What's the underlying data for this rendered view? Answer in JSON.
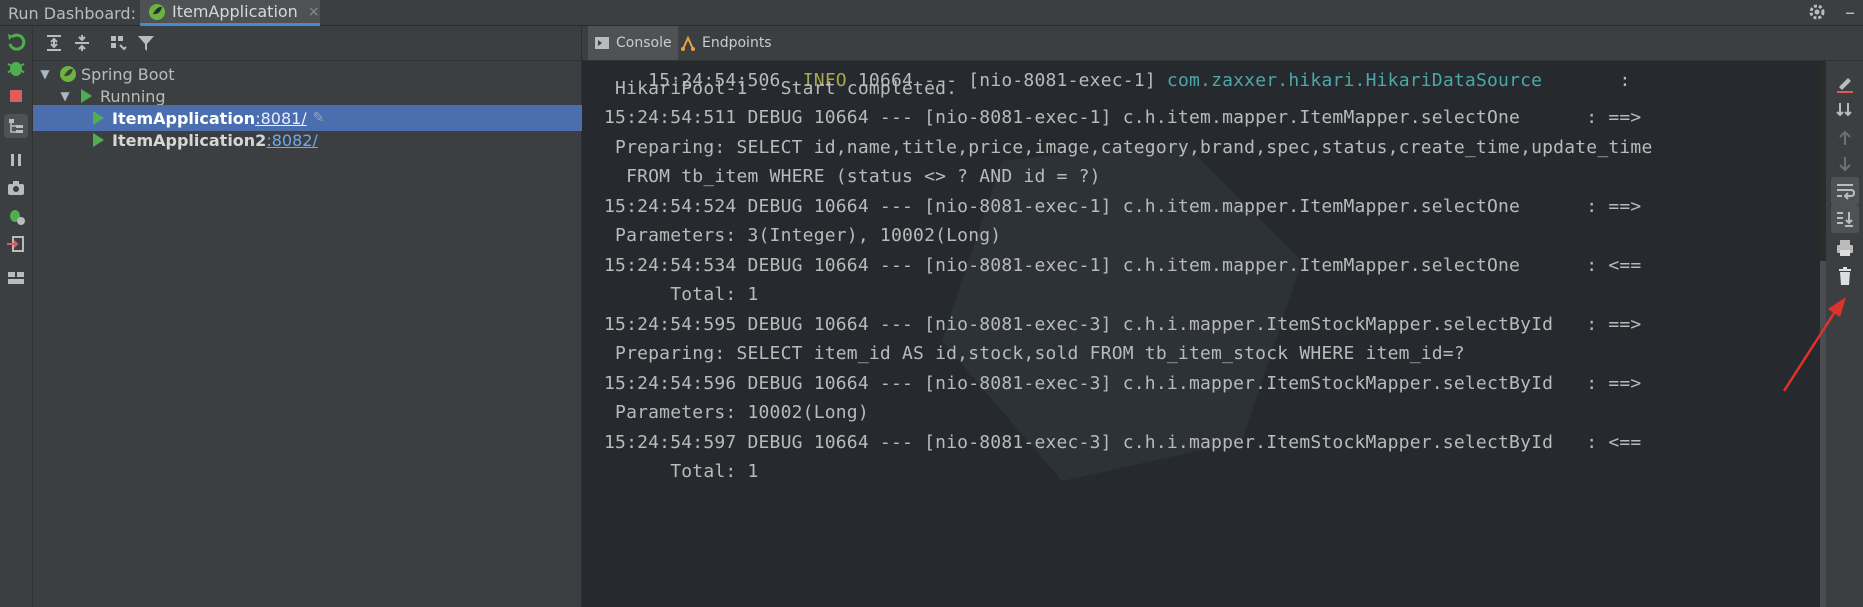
{
  "window": {
    "title": "Run Dashboard:",
    "tab_label": "ItemApplication",
    "tab_close": "×",
    "minimize": "–"
  },
  "tree": {
    "root_label": "Spring Boot",
    "group_label": "Running",
    "apps": [
      {
        "name": "ItemApplication",
        "port": ":8081/",
        "selected": true
      },
      {
        "name": "ItemApplication2",
        "port": ":8082/",
        "selected": false
      }
    ]
  },
  "tabs": {
    "console": "Console",
    "endpoints": "Endpoints"
  },
  "console": {
    "lines": [
      {
        "parts": [
          "15:24:54:506  ",
          "INFO",
          " 10664 --- [nio-8081-exec-1] ",
          "com.zaxxer.hikari.HikariDataSource",
          "       :"
        ]
      },
      {
        "text": " HikariPool-1 - Start completed."
      },
      {
        "text": "15:24:54:511 DEBUG 10664 --- [nio-8081-exec-1] c.h.item.mapper.ItemMapper.selectOne      : ==>"
      },
      {
        "text": " Preparing: SELECT id,name,title,price,image,category,brand,spec,status,create_time,update_time"
      },
      {
        "text": "  FROM tb_item WHERE (status <> ? AND id = ?)"
      },
      {
        "text": "15:24:54:524 DEBUG 10664 --- [nio-8081-exec-1] c.h.item.mapper.ItemMapper.selectOne      : ==>"
      },
      {
        "text": " Parameters: 3(Integer), 10002(Long)"
      },
      {
        "text": "15:24:54:534 DEBUG 10664 --- [nio-8081-exec-1] c.h.item.mapper.ItemMapper.selectOne      : <=="
      },
      {
        "text": "      Total: 1"
      },
      {
        "text": "15:24:54:595 DEBUG 10664 --- [nio-8081-exec-3] c.h.i.mapper.ItemStockMapper.selectById   : ==>"
      },
      {
        "text": " Preparing: SELECT item_id AS id,stock,sold FROM tb_item_stock WHERE item_id=?"
      },
      {
        "text": "15:24:54:596 DEBUG 10664 --- [nio-8081-exec-3] c.h.i.mapper.ItemStockMapper.selectById   : ==>"
      },
      {
        "text": " Parameters: 10002(Long)"
      },
      {
        "text": "15:24:54:597 DEBUG 10664 --- [nio-8081-exec-3] c.h.i.mapper.ItemStockMapper.selectById   : <=="
      },
      {
        "text": "      Total: 1"
      }
    ]
  },
  "colors": {
    "accent": "#4b6eaf",
    "run_green": "#4faf50",
    "annotation": "#e0312a"
  }
}
